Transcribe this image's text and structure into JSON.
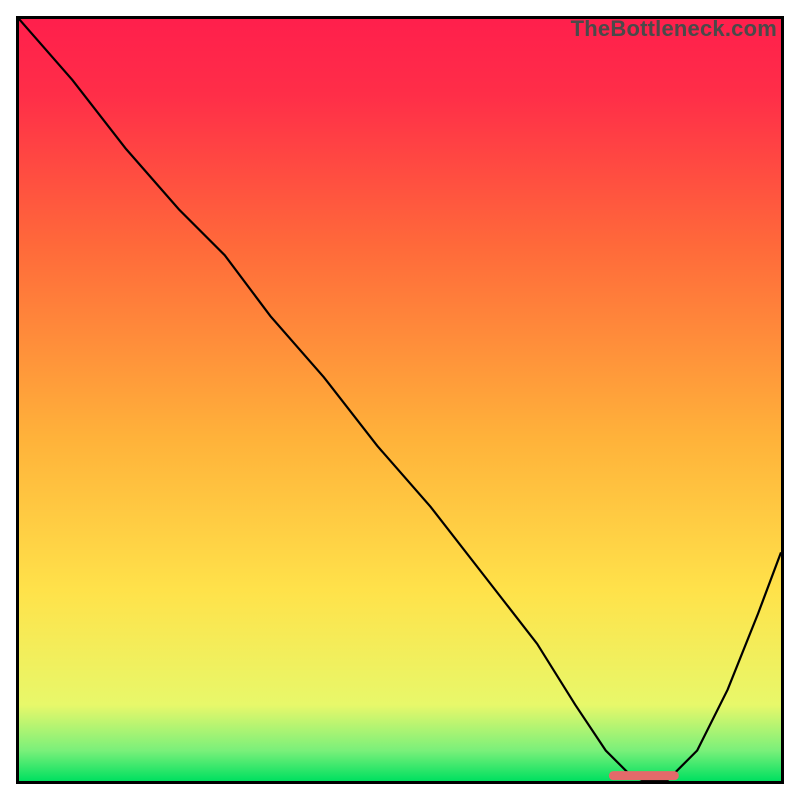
{
  "watermark": "TheBottleneck.com",
  "chart_data": {
    "type": "line",
    "title": "",
    "xlabel": "",
    "ylabel": "",
    "xlim": [
      0,
      100
    ],
    "ylim": [
      0,
      100
    ],
    "grid": false,
    "legend": false,
    "gradient_stops": [
      {
        "pos": 0.0,
        "color": "#00e060"
      },
      {
        "pos": 0.04,
        "color": "#7af07a"
      },
      {
        "pos": 0.1,
        "color": "#e8f86a"
      },
      {
        "pos": 0.25,
        "color": "#ffe24a"
      },
      {
        "pos": 0.45,
        "color": "#ffb23a"
      },
      {
        "pos": 0.7,
        "color": "#ff6a3a"
      },
      {
        "pos": 0.9,
        "color": "#ff2e48"
      },
      {
        "pos": 1.0,
        "color": "#ff1f4c"
      }
    ],
    "series": [
      {
        "name": "bottleneck-curve",
        "stroke": "#000000",
        "stroke_width": 2.2,
        "x": [
          0,
          7,
          14,
          21,
          27,
          33,
          40,
          47,
          54,
          61,
          68,
          73,
          77,
          80,
          82,
          85,
          89,
          93,
          97,
          100
        ],
        "y": [
          100,
          92,
          83,
          75,
          69,
          61,
          53,
          44,
          36,
          27,
          18,
          10,
          4,
          1,
          0,
          0,
          4,
          12,
          22,
          30
        ]
      }
    ],
    "marker": {
      "name": "recommended-segment",
      "type": "segment",
      "x": [
        78,
        86
      ],
      "y": [
        0.7,
        0.7
      ],
      "stroke": "#e46a6a",
      "stroke_width": 9,
      "linecap": "round"
    }
  }
}
